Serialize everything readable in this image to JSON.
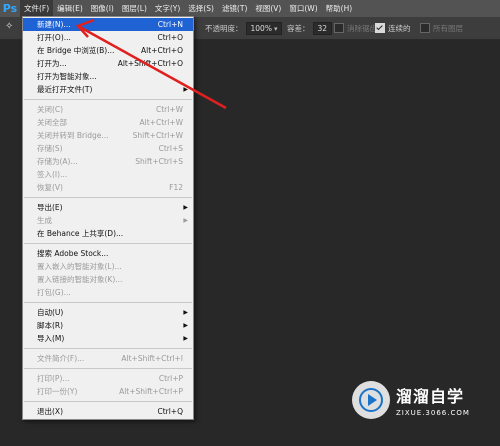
{
  "app": {
    "logo": "Ps"
  },
  "menubar": {
    "items": [
      {
        "label": "文件(F)",
        "active": true
      },
      {
        "label": "编辑(E)"
      },
      {
        "label": "图像(I)"
      },
      {
        "label": "图层(L)"
      },
      {
        "label": "文字(Y)"
      },
      {
        "label": "选择(S)"
      },
      {
        "label": "滤镜(T)"
      },
      {
        "label": "视图(V)"
      },
      {
        "label": "窗口(W)"
      },
      {
        "label": "帮助(H)"
      }
    ]
  },
  "options": {
    "opacity_label": "不透明度：",
    "opacity_value": "100%",
    "tolerance_label": "容差：",
    "tolerance_value": "32",
    "antialias_label": "消除锯齿",
    "contiguous_label": "连续的",
    "all_layers_label": "所有图层"
  },
  "file_menu": {
    "groups": [
      [
        {
          "label": "新建(N)...",
          "shortcut": "Ctrl+N",
          "highlighted": true
        },
        {
          "label": "打开(O)...",
          "shortcut": "Ctrl+O"
        },
        {
          "label": "在 Bridge 中浏览(B)...",
          "shortcut": "Alt+Ctrl+O"
        },
        {
          "label": "打开为...",
          "shortcut": "Alt+Shift+Ctrl+O"
        },
        {
          "label": "打开为智能对象..."
        },
        {
          "label": "最近打开文件(T)",
          "submenu": true
        }
      ],
      [
        {
          "label": "关闭(C)",
          "shortcut": "Ctrl+W",
          "disabled": true
        },
        {
          "label": "关闭全部",
          "shortcut": "Alt+Ctrl+W",
          "disabled": true
        },
        {
          "label": "关闭并转到 Bridge...",
          "shortcut": "Shift+Ctrl+W",
          "disabled": true
        },
        {
          "label": "存储(S)",
          "shortcut": "Ctrl+S",
          "disabled": true
        },
        {
          "label": "存储为(A)...",
          "shortcut": "Shift+Ctrl+S",
          "disabled": true
        },
        {
          "label": "签入(I)...",
          "disabled": true
        },
        {
          "label": "恢复(V)",
          "shortcut": "F12",
          "disabled": true
        }
      ],
      [
        {
          "label": "导出(E)",
          "submenu": true
        },
        {
          "label": "生成",
          "submenu": true,
          "disabled": true
        },
        {
          "label": "在 Behance 上共享(D)..."
        }
      ],
      [
        {
          "label": "搜索 Adobe Stock..."
        },
        {
          "label": "置入嵌入的智能对象(L)...",
          "disabled": true
        },
        {
          "label": "置入链接的智能对象(K)...",
          "disabled": true
        },
        {
          "label": "打包(G)...",
          "disabled": true
        }
      ],
      [
        {
          "label": "自动(U)",
          "submenu": true
        },
        {
          "label": "脚本(R)",
          "submenu": true
        },
        {
          "label": "导入(M)",
          "submenu": true
        }
      ],
      [
        {
          "label": "文件简介(F)...",
          "shortcut": "Alt+Shift+Ctrl+I",
          "disabled": true
        }
      ],
      [
        {
          "label": "打印(P)...",
          "shortcut": "Ctrl+P",
          "disabled": true
        },
        {
          "label": "打印一份(Y)",
          "shortcut": "Alt+Shift+Ctrl+P",
          "disabled": true
        }
      ],
      [
        {
          "label": "退出(X)",
          "shortcut": "Ctrl+Q"
        }
      ]
    ]
  },
  "watermark": {
    "title": "溜溜自学",
    "subtitle": "ZIXUE.3066.COM"
  },
  "colors": {
    "highlight": "#1f62d3",
    "annotation_arrow": "#e0201e",
    "ps_blue": "#31a8ff"
  }
}
